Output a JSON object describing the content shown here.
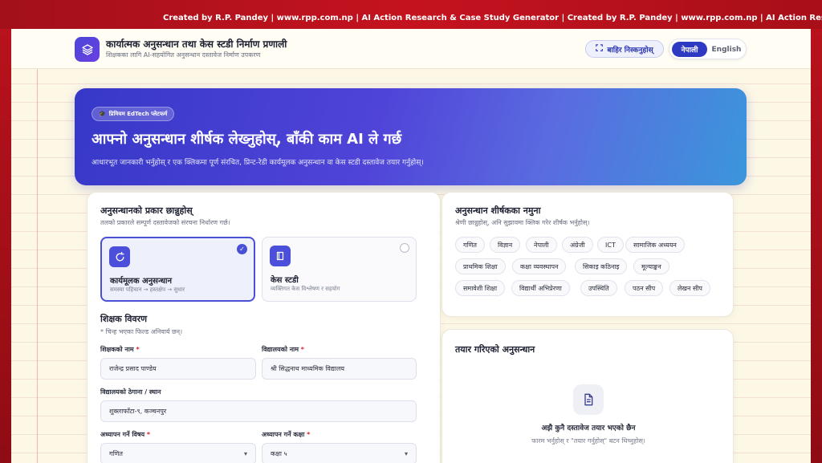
{
  "ticker": {
    "text": "Created by R.P. Pandey  |  www.rpp.com.np  |  AI Action Research & Case Study Generator  |  Created by R.P. Pandey  |  www.rpp.com.np  |  AI Action Research & Case Study Generator"
  },
  "header": {
    "title": "कार्यात्मक अनुसन्धान तथा केस स्टडी निर्माण प्रणाली",
    "subtitle": "शिक्षकका लागि AI-सहयोगित अनुसन्धान दस्तावेज निर्माण उपकरण",
    "exit_label": "बाहिर निस्कनुहोस्",
    "lang_np": "नेपाली",
    "lang_en": "English"
  },
  "hero": {
    "badge": "प्रिमियम EdTech प्लेटफर्म",
    "title": "आफ्नो अनुसन्धान शीर्षक लेख्नुहोस्, बाँकी काम AI ले गर्छ",
    "description": "आधारभूत जानकारी भर्नुहोस् र एक क्लिकमा पूर्ण संरचित, प्रिन्ट-रेडी कार्यमूलक अनुसन्धान वा केस स्टडी दस्तावेज तयार गर्नुहोस्।"
  },
  "research_type": {
    "heading": "अनुसन्धानको प्रकार छान्नुहोस्",
    "sub": "तलको प्रकारले सम्पूर्ण दस्तावेजको संरचना निर्धारण गर्छ।",
    "options": [
      {
        "name": "कार्यमूलक अनुसन्धान",
        "desc": "समस्या पहिचान → हस्तक्षेप → सुधार",
        "selected": true
      },
      {
        "name": "केस स्टडी",
        "desc": "व्यक्तिगत केस विश्लेषण र सहयोग",
        "selected": false
      }
    ]
  },
  "teacher": {
    "heading": "शिक्षक विवरण",
    "note": "* चिन्ह भएका फिल्ड अनिवार्य छन्।",
    "name_label": "शिक्षकको नाम",
    "name_value": "राजेन्द्र प्रसाद पाण्डेय",
    "school_label": "विद्यालयको नाम",
    "school_value": "श्री सिद्धनाथ माध्यमिक विद्यालय",
    "address_label": "विद्यालयको ठेगाना / स्थान",
    "address_value": "शुक्लाफाँटा-९, कञ्चनपुर",
    "subject_label": "अध्यापन गर्ने विषय",
    "subject_value": "गणित",
    "class_label": "अध्यापन गर्ने कक्षा",
    "class_value": "कक्षा ५",
    "required_mark": "*"
  },
  "samples": {
    "heading": "अनुसन्धान शीर्षकका नमुना",
    "sub": "श्रेणी छान्नुहोस्, अनि सुझावमा क्लिक गरेर शीर्षक भर्नुहोस्।",
    "chips": [
      "गणित",
      "विज्ञान",
      "नेपाली",
      "अंग्रेजी",
      "ICT",
      "सामाजिक अध्ययन",
      "प्राथमिक शिक्षा",
      "कक्षा व्यवस्थापन",
      "सिकाइ कठिनाइ",
      "मूल्याङ्कन",
      "समावेशी शिक्षा",
      "विद्यार्थी अभिप्रेरणा",
      "उपस्थिति",
      "पठन सीप",
      "लेखन सीप"
    ]
  },
  "generated": {
    "heading": "तयार गरिएको अनुसन्धान",
    "empty_title": "अझै कुनै दस्तावेज तयार भएको छैन",
    "empty_sub": "फारम भर्नुहोस् र \"तयार गर्नुहोस्\" बटन थिच्नुहोस्।"
  },
  "colors": {
    "ticker": "#b3121c",
    "accent": "#2d39c2",
    "hero_start": "#3738c8",
    "hero_end": "#3b96db"
  },
  "icons": {
    "logo": "layers-icon",
    "exit": "exit-icon",
    "badge": "graduation-cap-icon",
    "action": "refresh-icon",
    "case": "book-icon",
    "empty": "document-icon"
  }
}
